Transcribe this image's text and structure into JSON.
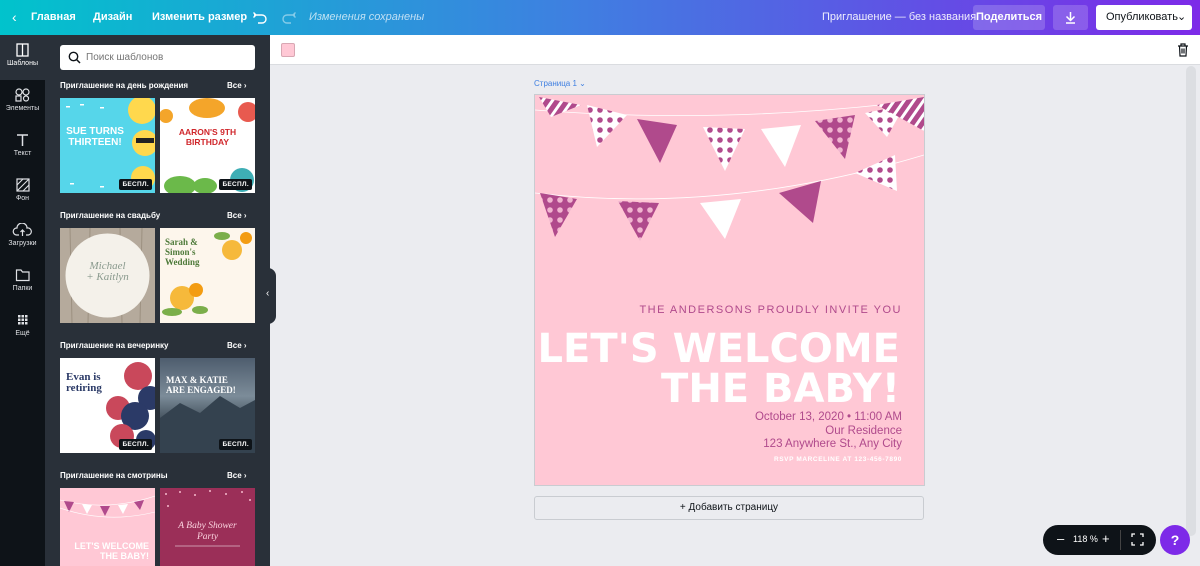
{
  "topbar": {
    "home": "Главная",
    "design": "Дизайн",
    "resize": "Изменить размер",
    "saved": "Изменения сохранены",
    "doc_title": "Приглашение — без названия",
    "share": "Поделиться",
    "publish": "Опубликовать",
    "gradient": [
      "#01c3cc",
      "#3f7fe1",
      "#7d2ae8"
    ]
  },
  "rail": [
    {
      "label": "Шаблоны",
      "icon": "templates-icon"
    },
    {
      "label": "Элементы",
      "icon": "elements-icon"
    },
    {
      "label": "Текст",
      "icon": "text-icon"
    },
    {
      "label": "Фон",
      "icon": "background-icon"
    },
    {
      "label": "Загрузки",
      "icon": "upload-icon"
    },
    {
      "label": "Папки",
      "icon": "folder-icon"
    },
    {
      "label": "Ещё",
      "icon": "more-grid-icon"
    }
  ],
  "panel": {
    "search_placeholder": "Поиск шаблонов",
    "all_label": "Все",
    "badge": "БЕСПЛ.",
    "sections": [
      {
        "title": "Приглашение на день рождения"
      },
      {
        "title": "Приглашение на свадьбу"
      },
      {
        "title": "Приглашение на вечеринку"
      },
      {
        "title": "Приглашение на смотрины"
      }
    ],
    "thumbs": {
      "sue": [
        "SUE TURNS",
        "THIRTEEN!"
      ],
      "aaron": [
        "AARON'S 9TH",
        "BIRTHDAY"
      ],
      "michael": [
        "Michael",
        "+ Kaitlyn"
      ],
      "sarah": [
        "Sarah &",
        "Simon's",
        "Wedding"
      ],
      "evan": [
        "Evan is",
        "retiring"
      ],
      "max": [
        "MAX & KATIE",
        "ARE ENGAGED!"
      ],
      "baby": [
        "LET'S WELCOME",
        "THE BABY!"
      ],
      "shower": [
        "A Baby Shower",
        "Party"
      ]
    }
  },
  "editor": {
    "page_label": "Страница 1",
    "add_page": "+ Добавить страницу",
    "swatch_color": "#ffc8d5"
  },
  "invite": {
    "line1": "THE ANDERSONS PROUDLY INVITE YOU",
    "headline1": "LET'S WELCOME",
    "headline2": "THE BABY!",
    "date": "October 13, 2020 • 11:00 AM",
    "place": "Our Residence",
    "address": "123 Anywhere St., Any City",
    "rsvp": "RSVP MARCELINE AT 123-456-7890",
    "bg_color": "#ffc8d5",
    "accent": "#b04a8c"
  },
  "zoom": {
    "value": "118 %"
  },
  "help": "?"
}
